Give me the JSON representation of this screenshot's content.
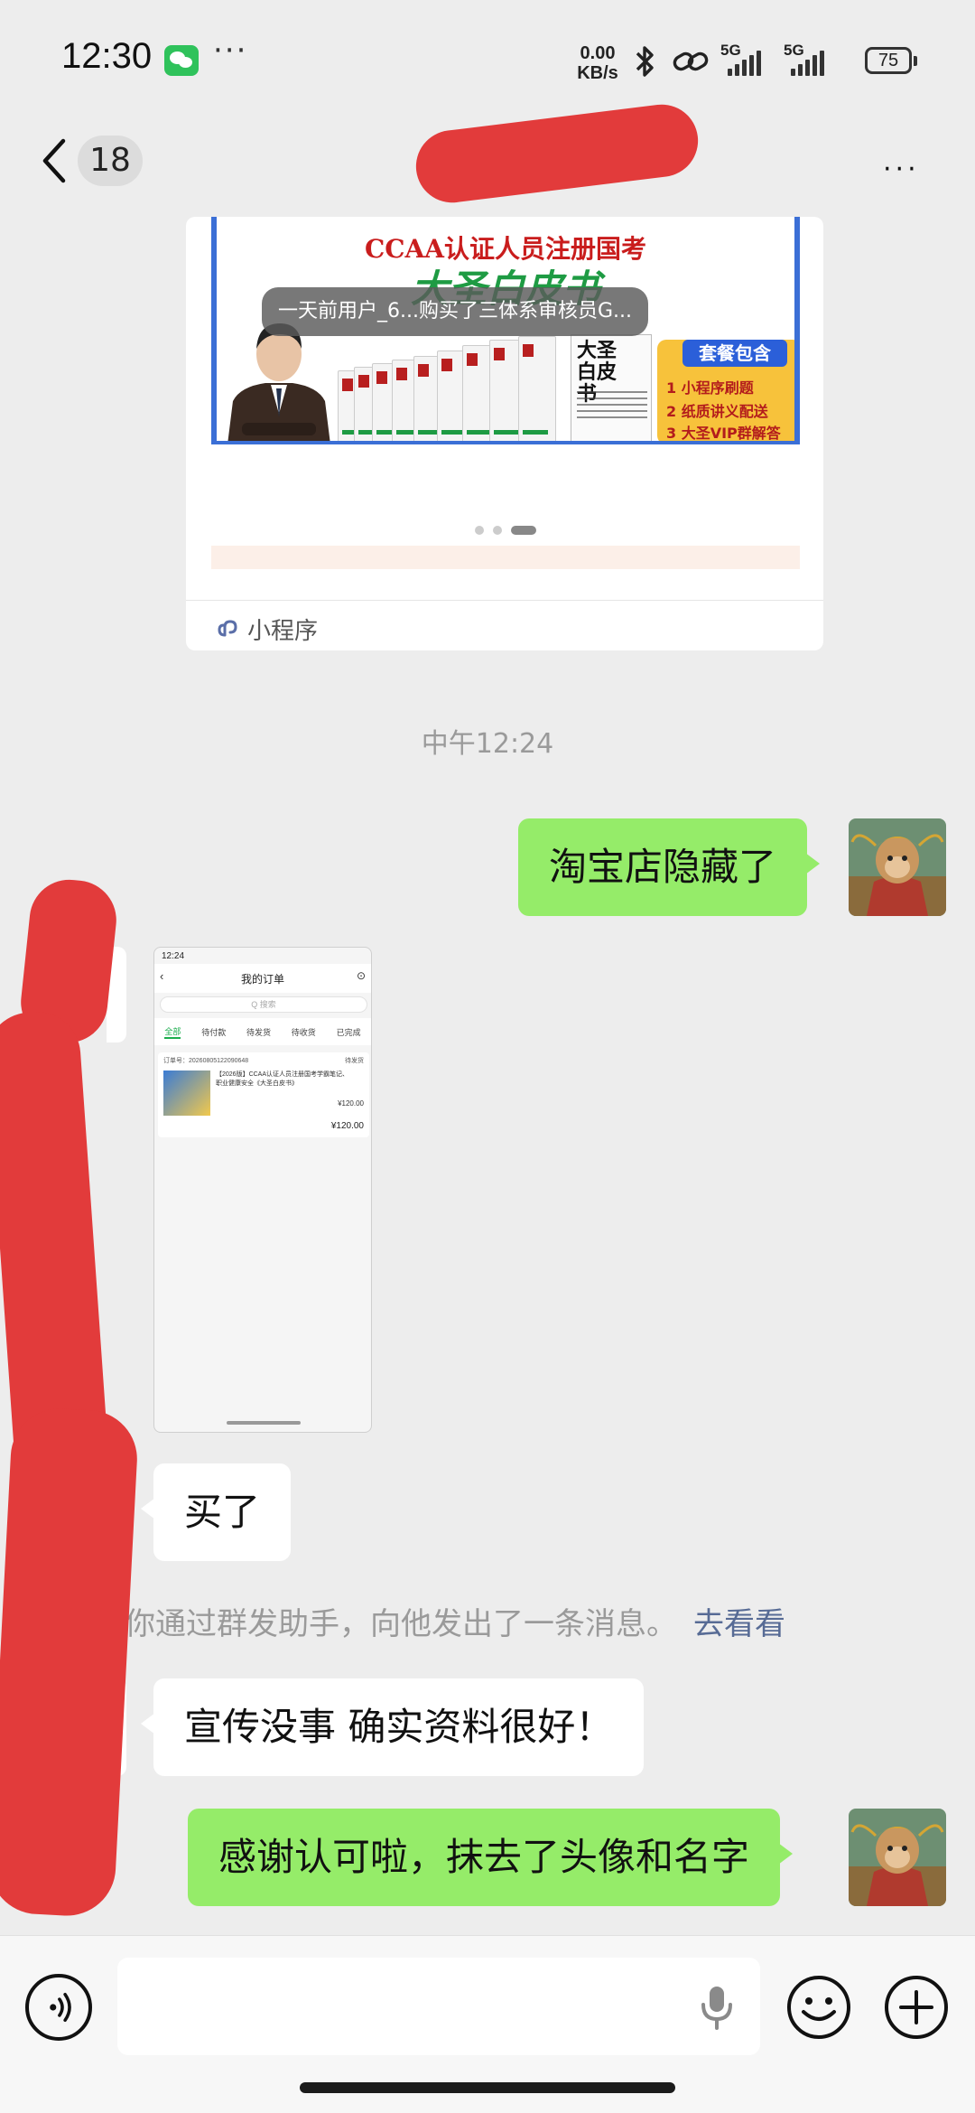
{
  "status_bar": {
    "time": "12:30",
    "more": "···",
    "net_speed_value": "0.00",
    "net_speed_unit": "KB/s",
    "signal1": "5G",
    "signal2": "5G",
    "battery": "75"
  },
  "nav": {
    "unread_count": "18",
    "more": "···"
  },
  "mini_program": {
    "banner_title": "CCAA认证人员注册国考",
    "banner_subtitle": "大圣白皮书",
    "book_title": "大圣白皮书",
    "package_title": "套餐包含",
    "package_items": [
      "1 小程序刷题",
      "2 纸质讲义配送",
      "3 大圣VIP群解答"
    ],
    "toast": "一天前用户_6...购买了三体系审核员G...",
    "footer_label": "小程序"
  },
  "time_divider": "中午12:24",
  "messages": {
    "m1": "淘宝店隐藏了",
    "m2": "买了",
    "m3": "宣传没事 确实资料很好！",
    "m4": "感谢认可啦，抹去了头像和名字"
  },
  "screenshot": {
    "time": "12:24",
    "title": "我的订单",
    "search_placeholder": "Q 搜索",
    "tabs": [
      "全部",
      "待付款",
      "待发货",
      "待收货",
      "已完成"
    ],
    "order_no": "订单号：20260805122090648",
    "order_status": "待发货",
    "product": "【2026版】CCAA认证人员注册国考学霸笔记、职业健康安全《大圣白皮书》",
    "price_each": "¥120.00",
    "price_total": "¥120.00"
  },
  "system_notice": {
    "text": "你通过群发助手，向他发出了一条消息。",
    "link": "去看看"
  },
  "colors": {
    "out_bubble": "#95ec69",
    "in_bubble": "#ffffff",
    "link": "#576b95",
    "redaction": "#e23b3b"
  }
}
